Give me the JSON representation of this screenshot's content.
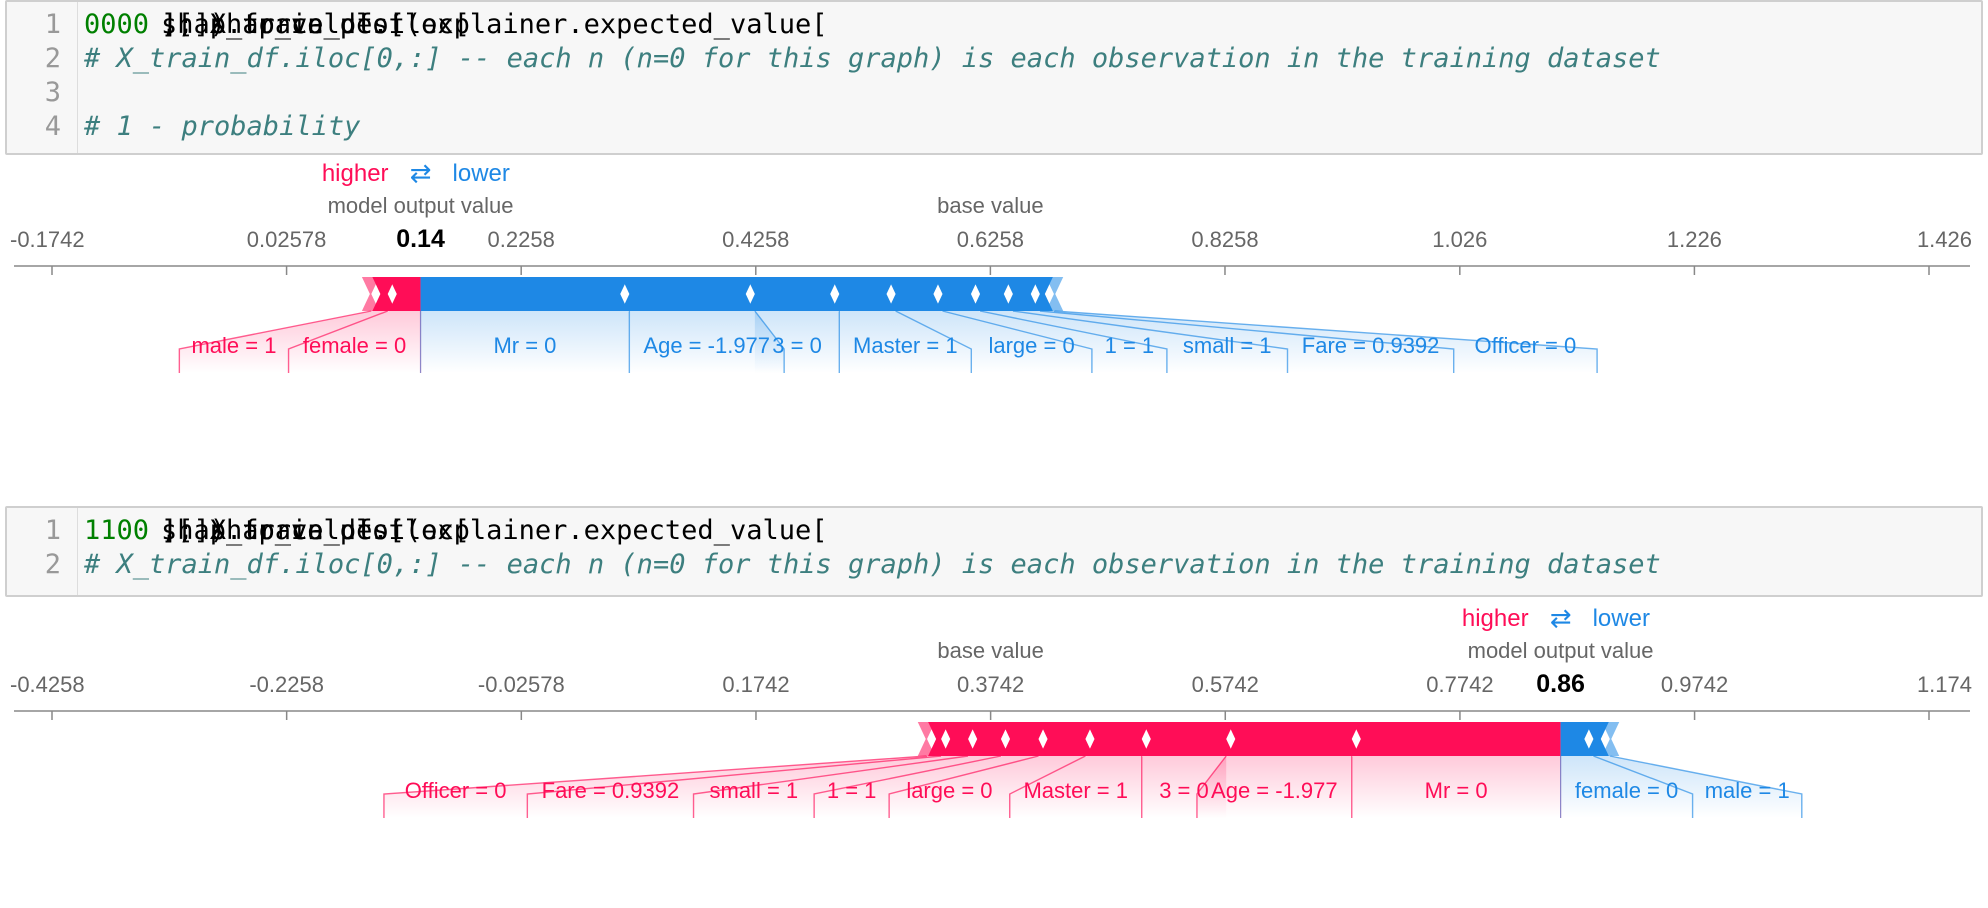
{
  "colors": {
    "positive": "#ff0d57",
    "negative": "#1e88e5",
    "axis": "#888888",
    "label": "#444444",
    "tick_text": "#666666"
  },
  "cells": [
    {
      "lines": [
        {
          "no": "1",
          "segments": [
            {
              "t": "shap.force_plot(explainer.expected_value[",
              "c": "code"
            },
            {
              "t": "0",
              "c": "num"
            },
            {
              "t": "], shap_values[",
              "c": "code"
            },
            {
              "t": "0",
              "c": "num"
            },
            {
              "t": "][",
              "c": "code"
            },
            {
              "t": "0",
              "c": "num"
            },
            {
              "t": "], X_train_df.iloc[",
              "c": "code"
            },
            {
              "t": "0",
              "c": "num"
            },
            {
              "t": ",:])",
              "c": "code"
            }
          ]
        },
        {
          "no": "2",
          "segments": [
            {
              "t": "# X_train_df.iloc[0,:] -- each n (n=0 for this graph) is each observation in the training dataset",
              "c": "comment"
            }
          ]
        },
        {
          "no": "3",
          "segments": []
        },
        {
          "no": "4",
          "segments": [
            {
              "t": "# 1 - probability",
              "c": "comment"
            }
          ]
        }
      ]
    },
    {
      "lines": [
        {
          "no": "1",
          "segments": [
            {
              "t": "shap.force_plot(explainer.expected_value[",
              "c": "code"
            },
            {
              "t": "1",
              "c": "num"
            },
            {
              "t": "], shap_values[",
              "c": "code"
            },
            {
              "t": "1",
              "c": "num"
            },
            {
              "t": "][",
              "c": "code"
            },
            {
              "t": "0",
              "c": "num"
            },
            {
              "t": "], X_train_df.iloc[",
              "c": "code"
            },
            {
              "t": "0",
              "c": "num"
            },
            {
              "t": ",:])",
              "c": "code"
            }
          ]
        },
        {
          "no": "2",
          "segments": [
            {
              "t": "# X_train_df.iloc[0,:] -- each n (n=0 for this graph) is each observation in the training dataset",
              "c": "comment"
            }
          ]
        }
      ]
    }
  ],
  "chart_data": [
    {
      "type": "force",
      "legend": {
        "higher": "higher",
        "arrows": "⇄",
        "lower": "lower"
      },
      "output_label": "model output value",
      "base_label": "base value",
      "output_value": 0.14,
      "output_value_text": "0.14",
      "base_value": 0.6258,
      "xlim": [
        -0.1742,
        1.426
      ],
      "ticks": [
        -0.1742,
        0.02578,
        0.2258,
        0.4258,
        0.6258,
        0.8258,
        1.026,
        1.226,
        1.426
      ],
      "tick_labels": [
        "-0.1742",
        "0.02578",
        "0.2258",
        "0.4258",
        "0.6258",
        "0.8258",
        "1.026",
        "1.226",
        "1.426"
      ],
      "positive_features": [
        {
          "label": "female = 0",
          "start": 0.14,
          "end": 0.112
        },
        {
          "label": "male = 1",
          "start": 0.112,
          "end": 0.098
        },
        {
          "label": "",
          "start": 0.098,
          "end": 0.09
        }
      ],
      "negative_features": [
        {
          "label": "Mr = 0",
          "start": 0.14,
          "end": 0.318
        },
        {
          "label": "Age = -1.977",
          "start": 0.318,
          "end": 0.425
        },
        {
          "label": "3 = 0",
          "start": 0.425,
          "end": 0.497
        },
        {
          "label": "Master = 1",
          "start": 0.497,
          "end": 0.545
        },
        {
          "label": "large = 0",
          "start": 0.545,
          "end": 0.585
        },
        {
          "label": "1 = 1",
          "start": 0.585,
          "end": 0.617
        },
        {
          "label": "small = 1",
          "start": 0.617,
          "end": 0.645
        },
        {
          "label": "Fare = 0.9392",
          "start": 0.645,
          "end": 0.668
        },
        {
          "label": "Officer = 0",
          "start": 0.668,
          "end": 0.68
        },
        {
          "label": "",
          "start": 0.68,
          "end": 0.6879
        }
      ]
    },
    {
      "type": "force",
      "legend": {
        "higher": "higher",
        "arrows": "⇄",
        "lower": "lower"
      },
      "output_label": "model output value",
      "base_label": "base value",
      "output_value": 0.86,
      "output_value_text": "0.86",
      "base_value": 0.3742,
      "xlim": [
        -0.4258,
        1.174
      ],
      "ticks": [
        -0.4258,
        -0.2258,
        -0.02578,
        0.1742,
        0.3742,
        0.5742,
        0.7742,
        0.9742,
        1.174
      ],
      "tick_labels": [
        "-0.4258",
        "-0.2258",
        "-0.02578",
        "0.1742",
        "0.3742",
        "0.5742",
        "0.7742",
        "0.9742",
        "1.174"
      ],
      "positive_features": [
        {
          "label": "Mr = 0",
          "start": 0.86,
          "end": 0.682
        },
        {
          "label": "Age = -1.977",
          "start": 0.682,
          "end": 0.575
        },
        {
          "label": "3 = 0",
          "start": 0.575,
          "end": 0.503
        },
        {
          "label": "Master = 1",
          "start": 0.503,
          "end": 0.455
        },
        {
          "label": "large = 0",
          "start": 0.455,
          "end": 0.415
        },
        {
          "label": "1 = 1",
          "start": 0.415,
          "end": 0.383
        },
        {
          "label": "small = 1",
          "start": 0.383,
          "end": 0.355
        },
        {
          "label": "Fare = 0.9392",
          "start": 0.355,
          "end": 0.332
        },
        {
          "label": "Officer = 0",
          "start": 0.332,
          "end": 0.32
        },
        {
          "label": "",
          "start": 0.32,
          "end": 0.3121
        }
      ],
      "negative_features": [
        {
          "label": "female = 0",
          "start": 0.86,
          "end": 0.888
        },
        {
          "label": "male = 1",
          "start": 0.888,
          "end": 0.902
        },
        {
          "label": "",
          "start": 0.902,
          "end": 0.91
        }
      ]
    }
  ]
}
